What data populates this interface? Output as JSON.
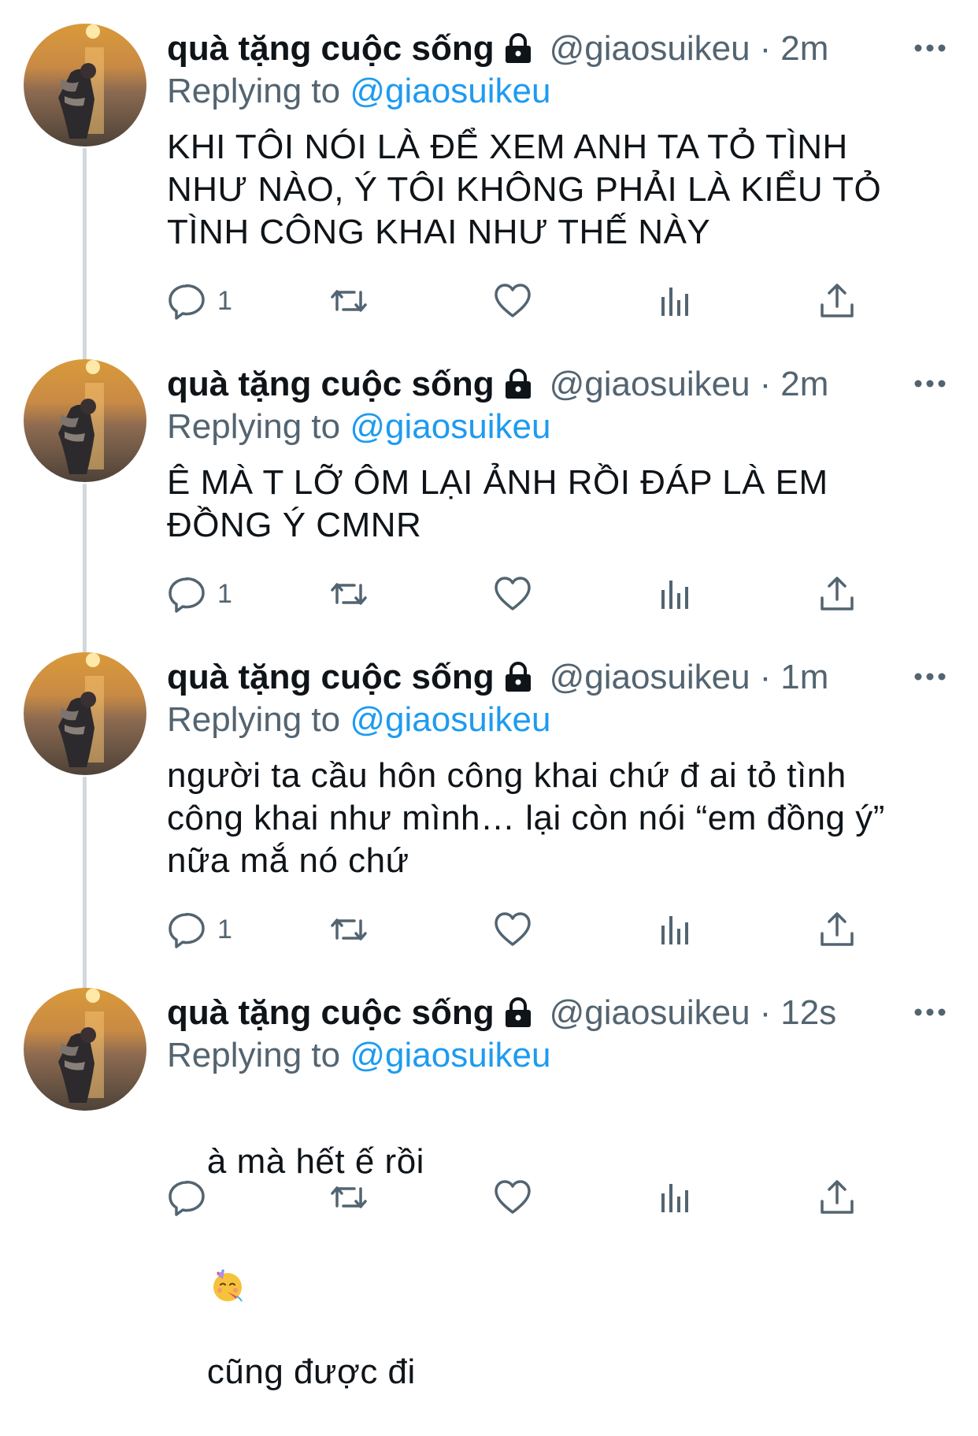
{
  "tweets": [
    {
      "name": "quà tặng cuộc sống",
      "handle": "@giaosuikeu",
      "separator": "·",
      "time": "2m",
      "replying_label": "Replying to",
      "replying_to": "@giaosuikeu",
      "text": "KHI TÔI NÓI LÀ ĐỂ XEM ANH TA TỎ TÌNH\nNHƯ NÀO, Ý TÔI KHÔNG PHẢI LÀ KIỂU TỎ\nTÌNH CÔNG KHAI NHƯ THẾ NÀY",
      "reply_count": "1"
    },
    {
      "name": "quà tặng cuộc sống",
      "handle": "@giaosuikeu",
      "separator": "·",
      "time": "2m",
      "replying_label": "Replying to",
      "replying_to": "@giaosuikeu",
      "text": "Ê MÀ T LỠ ÔM LẠI ẢNH RỒI ĐÁP LÀ EM\nĐỒNG Ý CMNR",
      "reply_count": "1"
    },
    {
      "name": "quà tặng cuộc sống",
      "handle": "@giaosuikeu",
      "separator": "·",
      "time": "1m",
      "replying_label": "Replying to",
      "replying_to": "@giaosuikeu",
      "text": "người ta cầu hôn công khai chứ đ ai tỏ tình\ncông khai như mình… lại còn nói “em đồng ý”\nnữa mắ nó chứ",
      "reply_count": "1"
    },
    {
      "name": "quà tặng cuộc sống",
      "handle": "@giaosuikeu",
      "separator": "·",
      "time": "12s",
      "replying_label": "Replying to",
      "replying_to": "@giaosuikeu",
      "text_before_emoji": "à mà hết ế rồi",
      "emoji": "partying-face-emoji",
      "text_after_emoji": "cũng được đi",
      "reply_count": ""
    }
  ],
  "icons": {
    "lock": "lock-icon",
    "more": "more-icon",
    "reply": "reply-icon",
    "retweet": "retweet-icon",
    "like": "like-icon",
    "analytics": "analytics-icon",
    "share": "share-icon"
  },
  "colors": {
    "text": "#0f1419",
    "secondary": "#536471",
    "link": "#1d9bf0",
    "thread_line": "#cfd9de"
  }
}
